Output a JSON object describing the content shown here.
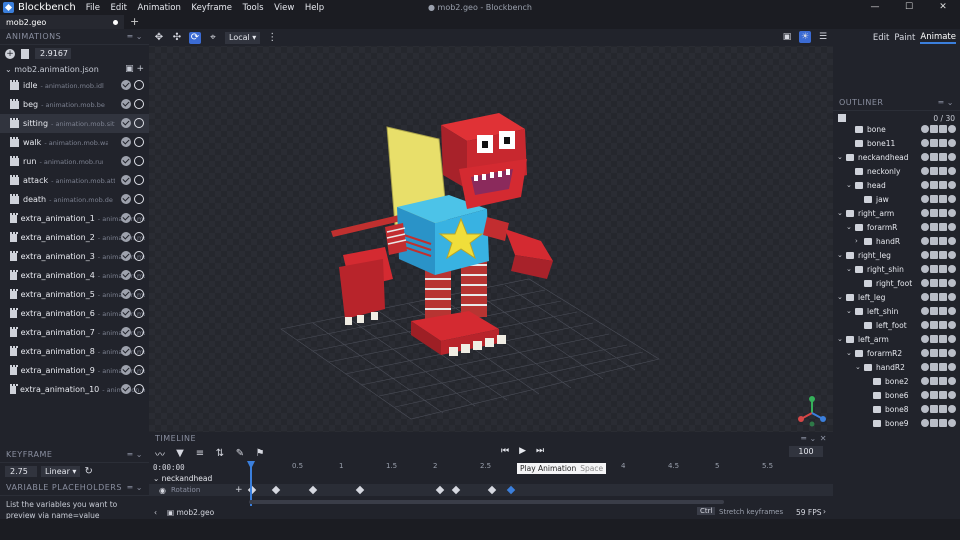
{
  "app": {
    "name": "Blockbench",
    "window_title": "● mob2.geo - Blockbench"
  },
  "menu": [
    "File",
    "Edit",
    "Animation",
    "Keyframe",
    "Tools",
    "View",
    "Help"
  ],
  "window_controls": [
    "—",
    "☐",
    "✕"
  ],
  "tabs": [
    {
      "label": "mob2.geo"
    }
  ],
  "modes": {
    "edit": "Edit",
    "paint": "Paint",
    "animate": "Animate"
  },
  "viewport": {
    "transform_space": "Local"
  },
  "animations_panel": {
    "title": "ANIMATIONS",
    "time_value": "2.9167",
    "file": "mob2.animation.json",
    "items": [
      {
        "name": "idle",
        "path": "- animation.mob.idle"
      },
      {
        "name": "beg",
        "path": "- animation.mob.beg"
      },
      {
        "name": "sitting",
        "path": "- animation.mob.sitting"
      },
      {
        "name": "walk",
        "path": "- animation.mob.walk"
      },
      {
        "name": "run",
        "path": "- animation.mob.run"
      },
      {
        "name": "attack",
        "path": "- animation.mob.attack"
      },
      {
        "name": "death",
        "path": "- animation.mob.death"
      },
      {
        "name": "extra_animation_1",
        "path": "- animation.mob.extra_animation_1"
      },
      {
        "name": "extra_animation_2",
        "path": "- animation.mob.extra_animation_2"
      },
      {
        "name": "extra_animation_3",
        "path": "- animation.mob.extra_animation_3"
      },
      {
        "name": "extra_animation_4",
        "path": "- animation.mob.extra_animation_4"
      },
      {
        "name": "extra_animation_5",
        "path": "- animation.mob.extra_animation_5"
      },
      {
        "name": "extra_animation_6",
        "path": "- animation.mob.extra_animation_6"
      },
      {
        "name": "extra_animation_7",
        "path": "- animation.mob.extra_animation_7"
      },
      {
        "name": "extra_animation_8",
        "path": "- animation.mob.extra_animation_8"
      },
      {
        "name": "extra_animation_9",
        "path": "- animation.mob.extra_animation_9"
      },
      {
        "name": "extra_animation_10",
        "path": "- animation.mob.extra_animation_10"
      }
    ]
  },
  "keyframe_panel": {
    "title": "KEYFRAME",
    "time": "2.75",
    "interpolation": "Linear"
  },
  "variable_panel": {
    "title": "VARIABLE PLACEHOLDERS",
    "text": "List the variables you want to preview via name=value"
  },
  "outliner": {
    "title": "OUTLINER",
    "count": "0 / 30",
    "items": [
      {
        "name": "bone",
        "depth": 1,
        "caret": ""
      },
      {
        "name": "bone11",
        "depth": 1,
        "caret": ""
      },
      {
        "name": "neckandhead",
        "depth": 0,
        "caret": "v"
      },
      {
        "name": "neckonly",
        "depth": 1,
        "caret": ""
      },
      {
        "name": "head",
        "depth": 1,
        "caret": "v"
      },
      {
        "name": "jaw",
        "depth": 2,
        "caret": ""
      },
      {
        "name": "right_arm",
        "depth": 0,
        "caret": "v"
      },
      {
        "name": "forarmR",
        "depth": 1,
        "caret": "v"
      },
      {
        "name": "handR",
        "depth": 2,
        "caret": ">"
      },
      {
        "name": "right_leg",
        "depth": 0,
        "caret": "v"
      },
      {
        "name": "right_shin",
        "depth": 1,
        "caret": "v"
      },
      {
        "name": "right_foot",
        "depth": 2,
        "caret": ""
      },
      {
        "name": "left_leg",
        "depth": 0,
        "caret": "v"
      },
      {
        "name": "left_shin",
        "depth": 1,
        "caret": "v"
      },
      {
        "name": "left_foot",
        "depth": 2,
        "caret": ""
      },
      {
        "name": "left_arm",
        "depth": 0,
        "caret": "v"
      },
      {
        "name": "forarmR2",
        "depth": 1,
        "caret": "v"
      },
      {
        "name": "handR2",
        "depth": 2,
        "caret": "v"
      },
      {
        "name": "bone2",
        "depth": 3,
        "caret": ""
      },
      {
        "name": "bone6",
        "depth": 3,
        "caret": ""
      },
      {
        "name": "bone8",
        "depth": 3,
        "caret": ""
      },
      {
        "name": "bone9",
        "depth": 3,
        "caret": ""
      }
    ]
  },
  "timeline": {
    "title": "TIMELINE",
    "current_time": "0:00:00",
    "speed": "100",
    "ticks": [
      "0.5",
      "1",
      "1.5",
      "2",
      "2.5",
      "3",
      "3.5",
      "4",
      "4.5",
      "5",
      "5.5"
    ],
    "group": "neckandhead",
    "channel": "Rotation",
    "keyframes": [
      0,
      0.25,
      0.65,
      1.15,
      2.0,
      2.17,
      2.55,
      2.75
    ],
    "selected_keyframe": 2.75,
    "tooltip": {
      "text": "Play Animation",
      "shortcut": "Space"
    }
  },
  "status": {
    "file": "mob2.geo",
    "ctrl": "Ctrl",
    "hint": "Stretch keyframes",
    "fps": "59 FPS"
  }
}
